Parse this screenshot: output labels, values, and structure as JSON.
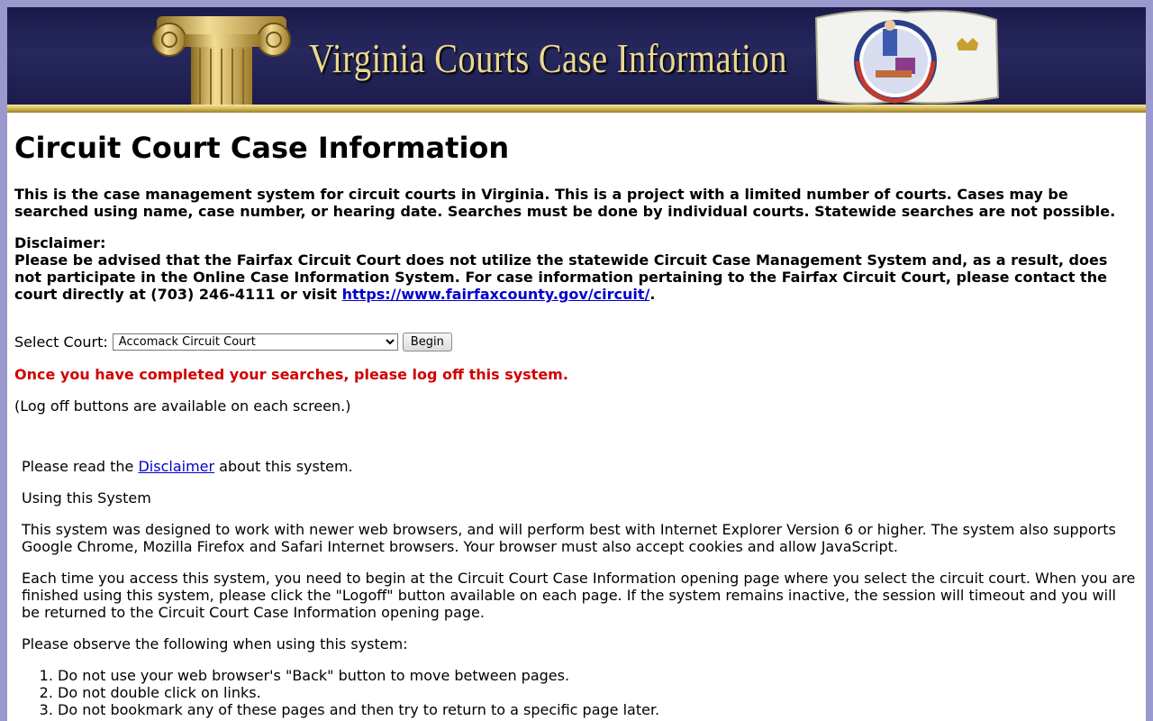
{
  "header": {
    "title": "Virginia Courts Case Information",
    "colors": {
      "banner_bg": "#1c1c4c",
      "title_gold": "#ead88f",
      "gold_bar": "#d8bf5c"
    }
  },
  "page": {
    "title": "Circuit Court Case Information",
    "intro_lines": [
      "This is the case management system for circuit courts in Virginia. This is a project with a limited number of courts. Cases may be",
      "searched using name, case number, or hearing date. Searches must be done by individual courts. Statewide searches are not possible."
    ],
    "disclaimer": {
      "label": "Disclaimer:",
      "line1": "Please be advised that the Fairfax Circuit Court does not utilize the statewide Circuit Case Management System and, as a result, does",
      "line2": "not participate in the Online Case Information System. For case information pertaining to the Fairfax Circuit Court, please contact the",
      "line3_before": "court directly at (703) 246-4111 or visit ",
      "link_text": "https://www.fairfaxcounty.gov/circuit/",
      "line3_after": "."
    },
    "court_select": {
      "label": "Select Court:",
      "selected": "Accomack Circuit Court",
      "button": "Begin"
    },
    "logoff_warning": "Once you have completed your searches, please log off this system.",
    "logoff_note": "(Log off buttons are available on each screen.)"
  },
  "info": {
    "read_before": "Please read the ",
    "read_link": "Disclaimer",
    "read_after": " about this system.",
    "using_heading": "Using this System",
    "para1": "This system was designed to work with newer web browsers, and will perform best with Internet Explorer Version 6 or higher. The system also supports Google Chrome, Mozilla Firefox and Safari Internet browsers. Your browser must also accept cookies and allow JavaScript.",
    "para2": "Each time you access this system, you need to begin at the Circuit Court Case Information opening page where you select the circuit court. When you are finished using this system, please click the \"Logoff\" button available on each page. If the system remains inactive, the session will timeout and you will be returned to the Circuit Court Case Information opening page.",
    "observe": "Please observe the following when using this system:",
    "rules": [
      "Do not use your web browser's \"Back\" button to move between pages.",
      "Do not double click on links.",
      "Do not bookmark any of these pages and then try to return to a specific page later."
    ]
  },
  "colors": {
    "page_border": "#9a98cc",
    "warning_red": "#d00000",
    "link_blue": "#0000cc"
  }
}
